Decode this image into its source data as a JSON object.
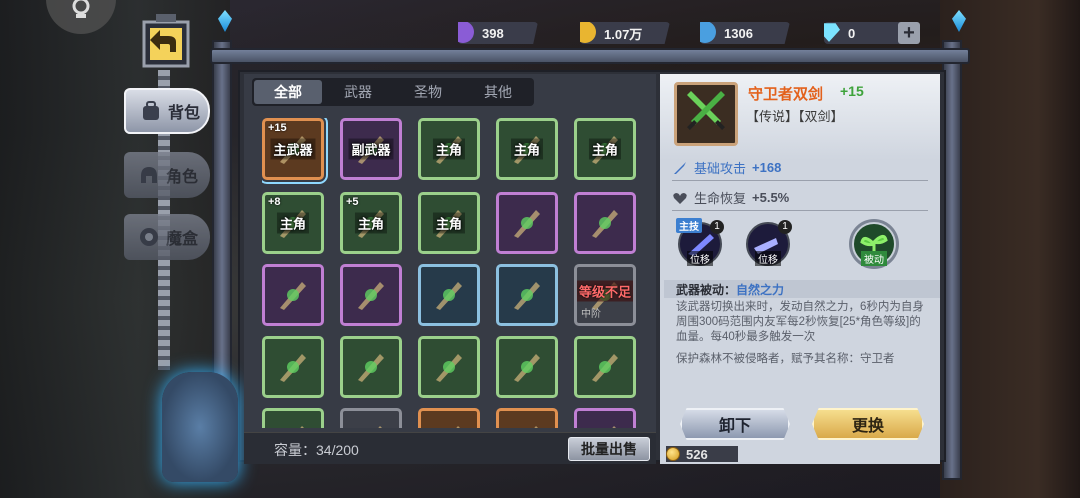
{
  "currencies": [
    {
      "name": "gem-purple",
      "value": "398",
      "color": "#8a5cd6"
    },
    {
      "name": "gold-coin",
      "value": "1.07万",
      "color": "#e9b530"
    },
    {
      "name": "blue-orb",
      "value": "1306",
      "color": "#4a9fe0"
    },
    {
      "name": "diamond",
      "value": "0",
      "color": "#7be3ff"
    }
  ],
  "side_nav": [
    {
      "label": "背包",
      "icon": "backpack-icon",
      "active": true
    },
    {
      "label": "角色",
      "icon": "helmet-icon",
      "active": false
    },
    {
      "label": "魔盒",
      "icon": "box-icon",
      "active": false
    }
  ],
  "tabs": [
    "全部",
    "武器",
    "圣物",
    "其他"
  ],
  "grid": [
    {
      "rarity": "orange",
      "level": "+15",
      "tag": "主武器",
      "icon": "twin-swords-icon",
      "selected": true
    },
    {
      "rarity": "purple",
      "level": "",
      "tag": "副武器",
      "icon": "claw-icon"
    },
    {
      "rarity": "green",
      "level": "",
      "tag": "主角",
      "icon": "helmet-icon"
    },
    {
      "rarity": "green",
      "level": "",
      "tag": "主角",
      "icon": "bracer-icon"
    },
    {
      "rarity": "green",
      "level": "",
      "tag": "主角",
      "icon": "amulet-icon"
    },
    {
      "rarity": "green",
      "level": "+8",
      "tag": "主角",
      "icon": "pendant-icon"
    },
    {
      "rarity": "green",
      "level": "+5",
      "tag": "主角",
      "icon": "chalice-icon"
    },
    {
      "rarity": "green",
      "level": "",
      "tag": "主角",
      "icon": "helmet-icon"
    },
    {
      "rarity": "purple",
      "level": "",
      "tag": "",
      "icon": "beast-axe-icon"
    },
    {
      "rarity": "purple",
      "level": "",
      "tag": "",
      "icon": "scythe-icon"
    },
    {
      "rarity": "purple",
      "level": "",
      "tag": "",
      "icon": "battle-axe-icon"
    },
    {
      "rarity": "purple",
      "level": "",
      "tag": "",
      "icon": "crossed-swords-icon"
    },
    {
      "rarity": "blue",
      "level": "",
      "tag": "",
      "icon": "double-axe-icon"
    },
    {
      "rarity": "blue",
      "level": "",
      "tag": "",
      "icon": "crossed-daggers-icon"
    },
    {
      "rarity": "grey",
      "level": "",
      "tag": "",
      "icon": "chest-icon",
      "warn": "等级不足",
      "sub": "中阶"
    },
    {
      "rarity": "green",
      "level": "",
      "tag": "",
      "icon": "medal-icon"
    },
    {
      "rarity": "green",
      "level": "",
      "tag": "",
      "icon": "goblet-icon"
    },
    {
      "rarity": "green",
      "level": "",
      "tag": "",
      "icon": "crown-icon"
    },
    {
      "rarity": "green",
      "level": "",
      "tag": "",
      "icon": "earrings-icon"
    },
    {
      "rarity": "green",
      "level": "",
      "tag": "",
      "icon": "ring-icon"
    },
    {
      "rarity": "green",
      "level": "",
      "tag": "",
      "icon": "item-icon"
    },
    {
      "rarity": "grey",
      "level": "",
      "tag": "",
      "icon": "item-icon"
    },
    {
      "rarity": "orange",
      "level": "",
      "tag": "",
      "icon": "item-icon"
    },
    {
      "rarity": "orange",
      "level": "",
      "tag": "",
      "icon": "item-icon"
    },
    {
      "rarity": "purple",
      "level": "",
      "tag": "",
      "icon": "item-icon"
    }
  ],
  "capacity": "容量：34/200",
  "sell_label": "批量出售",
  "detail": {
    "name": "守卫者双剑",
    "plus": "+15",
    "tags": "【传说】【双剑】",
    "stats": [
      {
        "icon": "sword-icon",
        "label": "基础攻击",
        "value": "+168",
        "color": "#3d72c3"
      },
      {
        "icon": "heart-icon",
        "label": "生命恢复",
        "value": "+5.5%",
        "color": "#4a4e5a"
      }
    ],
    "skills": [
      {
        "label": "位移",
        "count": "1",
        "top": "主技"
      },
      {
        "label": "位移",
        "count": "1",
        "top": ""
      },
      {
        "label": "被动",
        "count": "",
        "top": ""
      }
    ],
    "passive_title": "武器被动：",
    "passive_name": "自然之力",
    "description": "该武器切换出来时，发动自然之力，6秒内为自身周围300码范围内友军每2秒恢复[25*角色等级]的血量。每40秒最多触发一次",
    "lore": "保护森林不被侵略者，赋予其名称：守卫者",
    "unload_label": "卸下",
    "change_label": "更换",
    "gold": "526"
  }
}
